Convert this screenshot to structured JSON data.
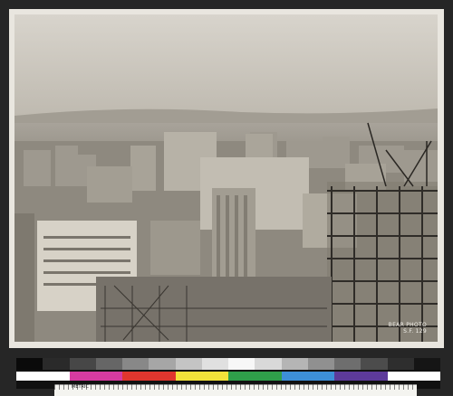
{
  "photo": {
    "credit_line1": "BEAR PHOTO",
    "credit_line2": "S.F.     129"
  },
  "target": {
    "ruler_label": "METRIC",
    "gray_patches": [
      "#0a0a0a",
      "#2a2a2a",
      "#474747",
      "#666666",
      "#888888",
      "#a6a6a6",
      "#c4c4c4",
      "#e0e0e0",
      "#f7f7f7",
      "#d9d9d9",
      "#b5b5b5",
      "#909090",
      "#6e6e6e",
      "#4c4c4c",
      "#2e2e2e",
      "#151515"
    ],
    "color_patches": [
      "#ffffff",
      "#d63ba0",
      "#e0362e",
      "#f2e23a",
      "#2f9e4a",
      "#3d8fd8",
      "#5d3a9a",
      "#ffffff"
    ]
  }
}
